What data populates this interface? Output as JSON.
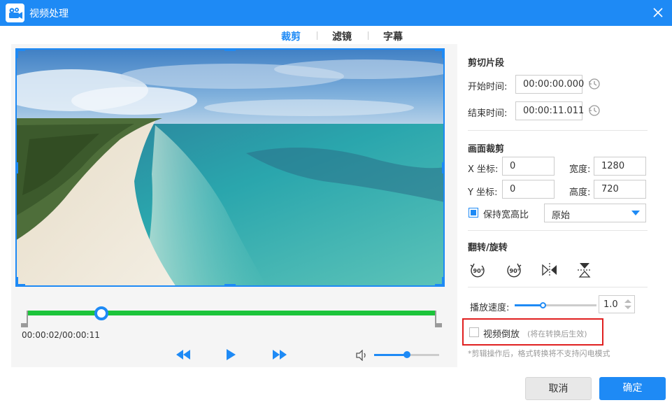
{
  "window": {
    "title": "视频处理"
  },
  "tabs": [
    {
      "label": "裁剪",
      "active": true
    },
    {
      "label": "滤镜",
      "active": false
    },
    {
      "label": "字幕",
      "active": false
    }
  ],
  "player": {
    "time": "00:00:02/00:00:11",
    "progress": 0.18,
    "volume": 0.5,
    "tooltip": "播放"
  },
  "trim": {
    "title": "剪切片段",
    "start_label": "开始时间:",
    "start_value": "00:00:00.000",
    "end_label": "结束时间:",
    "end_value": "00:00:11.011"
  },
  "crop": {
    "title": "画面裁剪",
    "x_label": "X 坐标:",
    "x_value": "0",
    "y_label": "Y 坐标:",
    "y_value": "0",
    "width_label": "宽度:",
    "width_value": "1280",
    "height_label": "高度:",
    "height_value": "720",
    "keep_ratio_label": "保持宽高比",
    "keep_ratio_checked": true,
    "ratio_option": "原始"
  },
  "flip": {
    "title": "翻转/旋转",
    "icons": [
      "rotate-cw-90-icon",
      "rotate-ccw-90-icon",
      "flip-horizontal-icon",
      "flip-vertical-icon"
    ]
  },
  "speed": {
    "label": "播放速度:",
    "value": "1.0"
  },
  "reverse": {
    "label": "视频倒放",
    "hint": "(将在转换后生效)",
    "checked": false
  },
  "note": "*剪辑操作后，格式转换将不支持闪电模式",
  "footer": {
    "cancel_label": "取消",
    "ok_label": "确定"
  },
  "colors": {
    "accent": "#1e8af5",
    "timeline": "#1cc43a",
    "highlight": "#e02020"
  }
}
